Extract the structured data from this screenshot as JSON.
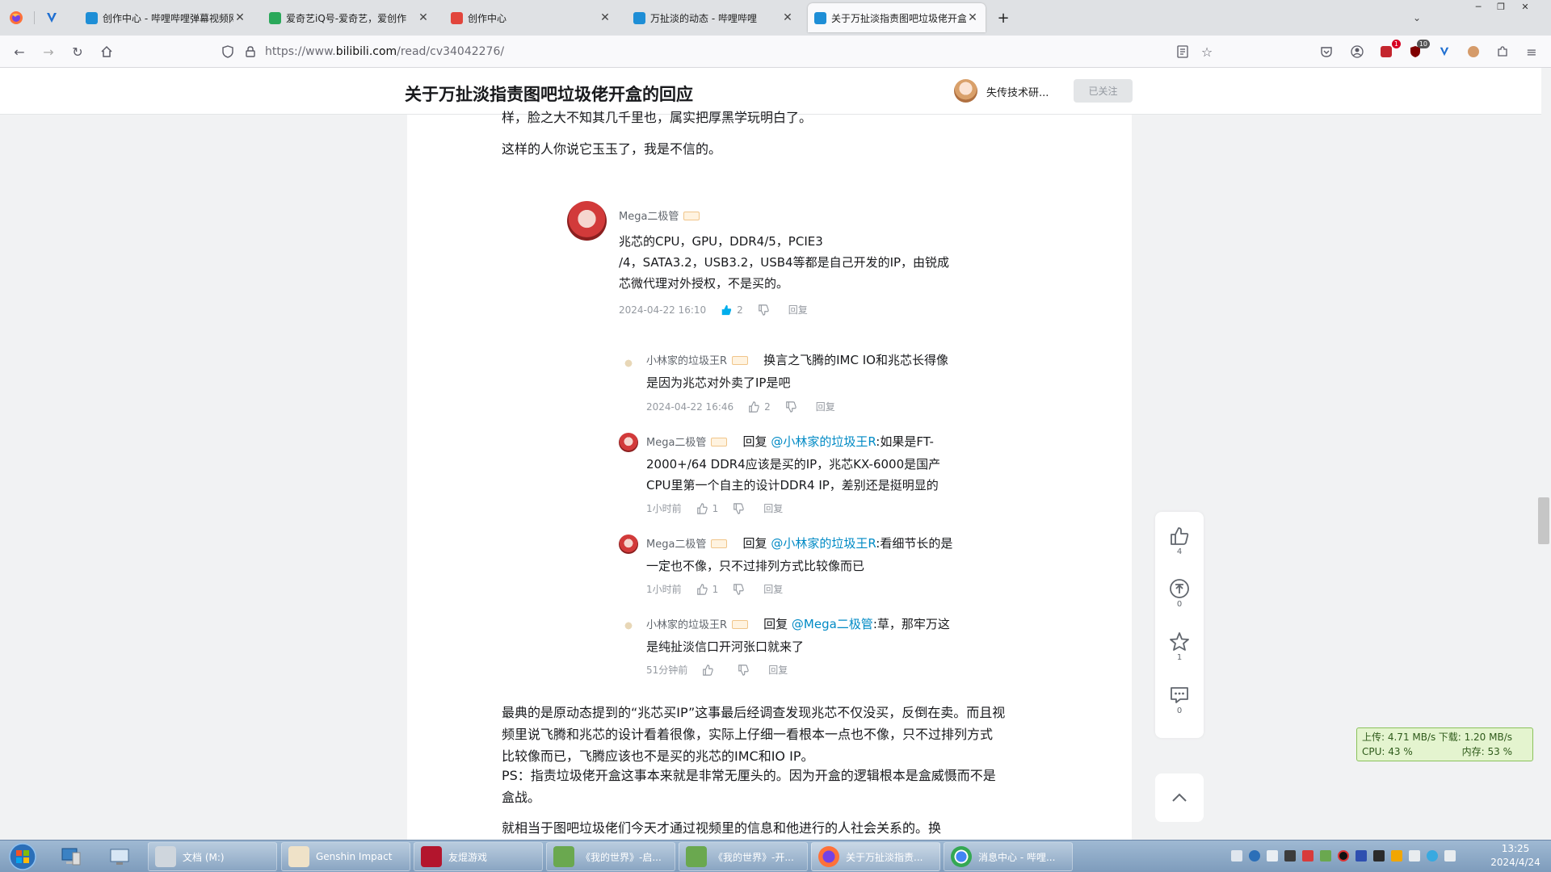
{
  "browser": {
    "tabs": [
      {
        "title": "创作中心 - 哔哩哔哩弹幕视频网",
        "active": false,
        "color": "#1e8ed6"
      },
      {
        "title": "爱奇艺iQ号-爱奇艺，爱创作",
        "active": false,
        "color": "#2aa85a"
      },
      {
        "title": "创作中心",
        "active": false,
        "color": "#e2453c"
      },
      {
        "title": "万扯淡的动态 - 哔哩哔哩",
        "active": false,
        "color": "#1e8ed6"
      },
      {
        "title": "关于万扯淡指责图吧垃圾佬开盒的回应",
        "active": true,
        "color": "#1e8ed6"
      }
    ],
    "new_tab": "+",
    "url_proto": "https://www.",
    "url_host": "bilibili.com",
    "url_path": "/read/cv34042276/",
    "ext_badge_1": "1",
    "ext_badge_2": "10"
  },
  "header": {
    "title": "关于万扯淡指责图吧垃圾佬开盒的回应",
    "author": "失传技术研...",
    "follow_label": "已关注"
  },
  "article": {
    "para_top_1": "样，脸之大不知其几千里也，属实把厚黑学玩明白了。",
    "para_top_2": "这样的人你说它玉玉了，我是不信的。",
    "para_bottom_1a": "最典的是原动态提到的“兆芯买IP”这事最后经调查发现兆芯不仅没买，反倒在卖。而且视",
    "para_bottom_1b": "频里说飞腾和兆芯的设计看着很像，实际上仔细一看根本一点也不像，只不过排列方式",
    "para_bottom_1c": "比较像而已，飞腾应该也不是买的兆芯的IMC和IO IP。",
    "para_bottom_2a": "PS：指责垃圾佬开盒这事本来就是非常无厘头的。因为开盒的逻辑根本是盒威慑而不是",
    "para_bottom_2b": "盒战。",
    "para_bottom_3": "就相当于图吧垃圾佬们今天才通过视频里的信息和他进行的人社会关系的。换"
  },
  "comments": {
    "main": {
      "user": "Mega二极管",
      "line1": "兆芯的CPU，GPU，DDR4/5，PCIE3",
      "line2": "/4，SATA3.2，USB3.2，USB4等都是自己开发的IP，由锐成",
      "line3": "芯微代理对外授权，不是买的。",
      "time": "2024-04-22 16:10",
      "likes": "2",
      "reply": "回复"
    },
    "replies": [
      {
        "user": "小林家的垃圾王R",
        "line1": "换言之飞腾的IMC IO和兆芯长得像",
        "line2": "是因为兆芯对外卖了IP是吧",
        "time": "2024-04-22 16:46",
        "likes": "2",
        "reply": "回复"
      },
      {
        "user": "Mega二极管",
        "reply_word": "回复",
        "mention": "@小林家的垃圾王R",
        "line1": ":如果是FT-",
        "line2": "2000+/64  DDR4应该是买的IP，兆芯KX-6000是国产",
        "line3": "CPU里第一个自主的设计DDR4 IP，差别还是挺明显的",
        "time": "1小时前",
        "likes": "1",
        "reply": "回复"
      },
      {
        "user": "Mega二极管",
        "reply_word": "回复",
        "mention": "@小林家的垃圾王R",
        "line1": ":看细节长的是",
        "line2": "一定也不像，只不过排列方式比较像而已",
        "time": "1小时前",
        "likes": "1",
        "reply": "回复"
      },
      {
        "user": "小林家的垃圾王R",
        "reply_word": "回复",
        "mention": "@Mega二极管",
        "line1": ":草，那牢万这",
        "line2": "是纯扯淡信口开河张口就来了",
        "time": "51分钟前",
        "likes": "",
        "reply": "回复"
      }
    ]
  },
  "toolbar": {
    "like_count": "4",
    "coin_count": "0",
    "fav_count": "1",
    "comment_count": "0"
  },
  "netwidget": {
    "up": "上传: 4.71 MB/s",
    "down": "下载: 1.20 MB/s",
    "cpu": "CPU: 43 %",
    "mem": "内存: 53 %"
  },
  "taskbar": {
    "items": [
      {
        "label": "文档 (M:)"
      },
      {
        "label": "Genshin Impact"
      },
      {
        "label": "友焜游戏"
      },
      {
        "label": "《我的世界》-启..."
      },
      {
        "label": "《我的世界》-开..."
      },
      {
        "label": "关于万扯淡指责..."
      },
      {
        "label": "消息中心 - 哔哩..."
      }
    ],
    "time": "13:25",
    "date": "2024/4/24"
  }
}
